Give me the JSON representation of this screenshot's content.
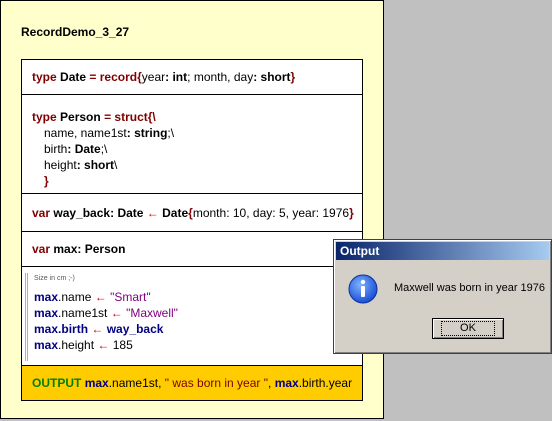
{
  "program": {
    "title": "RecordDemo_3_27"
  },
  "date_decl": {
    "kw_type": "type",
    "name": "Date",
    "eq": "=",
    "kw_record": "record",
    "open": "{",
    "f1": "year",
    "c1": ":",
    "t1": "int",
    "semi1": ";",
    "f2": "month, day",
    "c2": ":",
    "t2": "short",
    "close": "}"
  },
  "person_decl": {
    "kw_type": "type",
    "name": "Person",
    "eq": "=",
    "kw_struct": "struct",
    "open": "{\\",
    "l1_names": "name, name1st",
    "l1_colon": ":",
    "l1_type": "string",
    "l1_end": ";\\",
    "l2_name": "birth",
    "l2_colon": ":",
    "l2_type": "Date",
    "l2_end": ";\\",
    "l3_name": "height",
    "l3_colon": ":",
    "l3_type": "short",
    "l3_end": "\\",
    "close": "}"
  },
  "way_decl": {
    "kw_var": "var",
    "name": "way_back",
    "colon": ":",
    "type": "Date",
    "arrow": "←",
    "ctor": "Date",
    "open": "{",
    "a1": "month",
    "v1": "10",
    "a2": "day",
    "v2": "5",
    "a3": "year",
    "v3": "1976",
    "close": "}"
  },
  "max_decl": {
    "kw_var": "var",
    "name": "max",
    "colon": ":",
    "type": "Person"
  },
  "assign": {
    "note": "Size in cm ;-)",
    "rows": [
      {
        "obj": "max",
        "field": ".name",
        "arrow": "←",
        "value": "\"Smart\""
      },
      {
        "obj": "max",
        "field": ".name1st",
        "arrow": "←",
        "value": "\"Maxwell\""
      },
      {
        "obj": "max",
        "field": ".birth",
        "arrow": "←",
        "value": "way_back"
      },
      {
        "obj": "max",
        "field": ".height",
        "arrow": "←",
        "value": "185"
      }
    ]
  },
  "output_stmt": {
    "kw": "OUTPUT",
    "obj1": "max",
    "f1": ".name1st",
    "sep1": ",",
    "str": "\" was born in year \"",
    "sep2": ",",
    "obj2": "max",
    "f2": ".birth.year"
  },
  "dialog": {
    "title": "Output",
    "icon": "info-icon",
    "message": "Maxwell was born in year 1976",
    "ok_label": "OK",
    "titlebar_color": "#0a246a"
  }
}
